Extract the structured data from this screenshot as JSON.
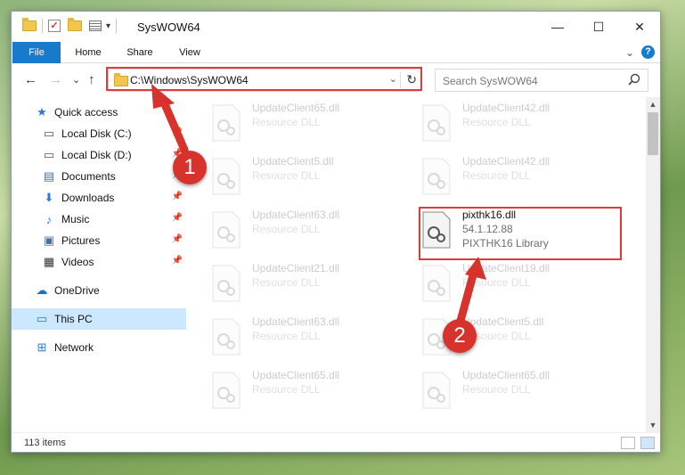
{
  "window": {
    "title": "SysWOW64",
    "controls": {
      "minimize": "—",
      "maximize": "☐",
      "close": "✕"
    }
  },
  "ribbon": {
    "tabs": [
      "File",
      "Home",
      "Share",
      "View"
    ],
    "help": "?",
    "expand": "⌄"
  },
  "address": {
    "path": "C:\\Windows\\SysWOW64",
    "search_placeholder": "Search SysWOW64"
  },
  "nav": {
    "back": "←",
    "forward": "→",
    "recent": "⌄",
    "up": "↑",
    "dropdown": "⌄",
    "refresh": "↻"
  },
  "sidebar": {
    "items": [
      {
        "label": "Quick access",
        "icon": "star-icon",
        "glyph": "★",
        "color": "#2b7bd6"
      },
      {
        "label": "Local Disk (C:)",
        "icon": "drive-icon",
        "glyph": "▭",
        "color": "#555555",
        "pin": "📌"
      },
      {
        "label": "Local Disk (D:)",
        "icon": "drive-icon",
        "glyph": "▭",
        "color": "#555555",
        "pin": "📌"
      },
      {
        "label": "Documents",
        "icon": "documents-icon",
        "glyph": "▤",
        "color": "#4a6d9a",
        "pin": "📌"
      },
      {
        "label": "Downloads",
        "icon": "download-icon",
        "glyph": "⬇",
        "color": "#2b7bd6",
        "pin": "📌"
      },
      {
        "label": "Music",
        "icon": "music-icon",
        "glyph": "♪",
        "color": "#2b7bd6",
        "pin": "📌"
      },
      {
        "label": "Pictures",
        "icon": "pictures-icon",
        "glyph": "▣",
        "color": "#4a6d9a",
        "pin": "📌"
      },
      {
        "label": "Videos",
        "icon": "videos-icon",
        "glyph": "▦",
        "color": "#333333",
        "pin": "📌"
      },
      {
        "label": "OneDrive",
        "icon": "cloud-icon",
        "glyph": "☁",
        "color": "#1a6fc9"
      },
      {
        "label": "This PC",
        "icon": "computer-icon",
        "glyph": "▭",
        "color": "#2b7bd6"
      },
      {
        "label": "Network",
        "icon": "network-icon",
        "glyph": "⊞",
        "color": "#2b7bd6"
      }
    ]
  },
  "files": [
    {
      "name": "UpdateClient65.dll",
      "type": "Resource DLL"
    },
    {
      "name": "UpdateClient42.dll",
      "type": "Resource DLL"
    },
    {
      "name": "UpdateClient5.dll",
      "type": "Resource DLL"
    },
    {
      "name": "UpdateClient42.dll",
      "type": "Resource DLL"
    },
    {
      "name": "UpdateClient63.dll",
      "type": "Resource DLL"
    },
    {
      "name": "pixthk16.dll",
      "version": "54.1.12.88",
      "type": "PIXTHK16 Library"
    },
    {
      "name": "UpdateClient21.dll",
      "type": "Resource DLL"
    },
    {
      "name": "UpdateClient19.dll",
      "type": "Resource DLL"
    },
    {
      "name": "UpdateClient63.dll",
      "type": "Resource DLL"
    },
    {
      "name": "UpdateClient5.dll",
      "type": "Resource DLL"
    },
    {
      "name": "UpdateClient65.dll",
      "type": "Resource DLL"
    },
    {
      "name": "UpdateClient65.dll",
      "type": "Resource DLL"
    }
  ],
  "status": {
    "count": "113 items"
  },
  "callouts": [
    "1",
    "2"
  ],
  "colors": {
    "accent": "#1979ca",
    "highlight": "#e03a3a",
    "callout": "#d8322c",
    "selected": "#cce8ff"
  }
}
